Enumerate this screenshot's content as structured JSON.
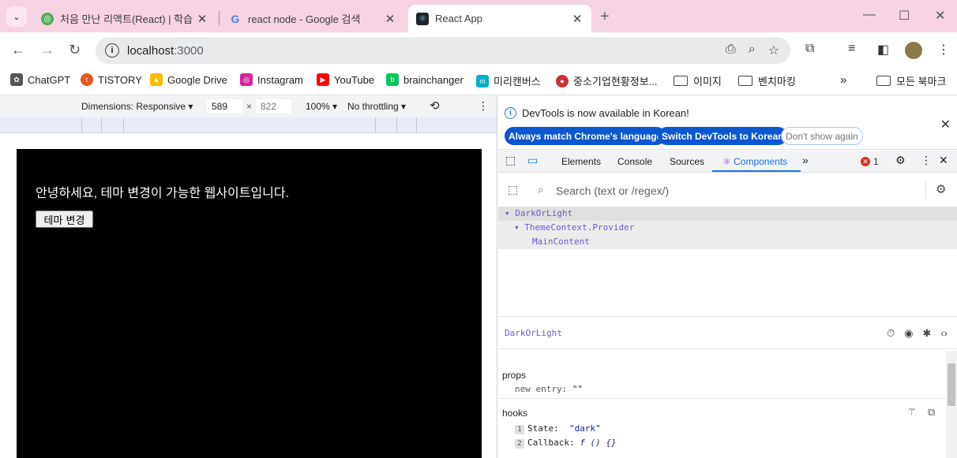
{
  "tabs": [
    {
      "title": "처음 만난 리액트(React) | 학습",
      "favicon": "course-icon"
    },
    {
      "title": "react node - Google 검색",
      "favicon": "google-icon"
    },
    {
      "title": "React App",
      "favicon": "react-icon",
      "active": true
    }
  ],
  "address": {
    "host": "localhost",
    "port": ":3000"
  },
  "bookmarks": [
    {
      "label": "ChatGPT"
    },
    {
      "label": "TISTORY"
    },
    {
      "label": "Google Drive"
    },
    {
      "label": "Instagram"
    },
    {
      "label": "YouTube"
    },
    {
      "label": "brainchanger"
    },
    {
      "label": "미리캔버스"
    },
    {
      "label": "중소기업현황정보..."
    },
    {
      "label": "이미지"
    },
    {
      "label": "벤치마킹"
    },
    {
      "label": "모든 북마크"
    }
  ],
  "device_toolbar": {
    "dimensions_label": "Dimensions: Responsive",
    "width": "589",
    "times": "×",
    "height": "822",
    "zoom": "100%",
    "throttle": "No throttling"
  },
  "page": {
    "greeting": "안녕하세요, 테마 변경이 가능한 웹사이트입니다.",
    "theme_button": "테마 변경"
  },
  "devtools": {
    "infobar_text": "DevTools is now available in Korean!",
    "btn_match": "Always match Chrome's language",
    "btn_switch": "Switch DevTools to Korean",
    "btn_dismiss": "Don't show again",
    "tabs": [
      "Elements",
      "Console",
      "Sources",
      "Components"
    ],
    "error_count": "1",
    "search_placeholder": "Search (text or /regex/)",
    "tree": [
      "DarkOrLight",
      "ThemeContext.Provider",
      "MainContent"
    ],
    "selected_component": "DarkOrLight",
    "props_title": "props",
    "prop_key": "new entry:",
    "prop_value": "\"\"",
    "hooks_title": "hooks",
    "hooks": [
      {
        "index": "1",
        "name": "State:",
        "value": "\"dark\""
      },
      {
        "index": "2",
        "name": "Callback:",
        "value": "f () {}"
      }
    ]
  },
  "colors": {
    "tabstrip": "#f6d3e3",
    "accent": "#1a73e8",
    "component": "#6a5acd"
  }
}
